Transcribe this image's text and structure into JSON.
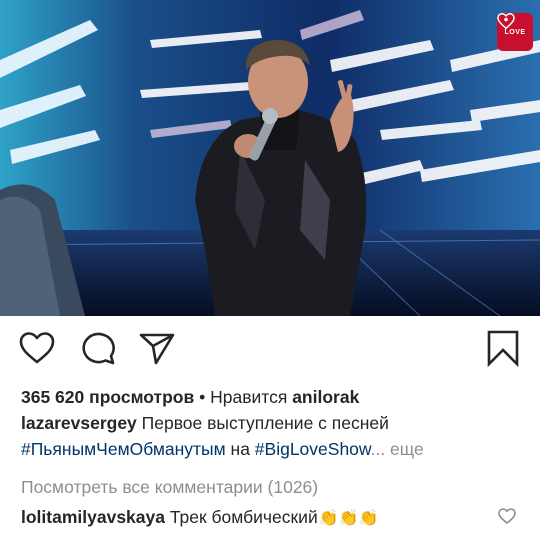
{
  "video": {
    "badge_text": "LOVE",
    "badge_color": "#c8102e"
  },
  "actions": {
    "like_icon": "heart-outline-icon",
    "comment_icon": "speech-bubble-icon",
    "share_icon": "paper-plane-icon",
    "save_icon": "bookmark-icon"
  },
  "stats": {
    "views": "365 620 просмотров",
    "separator": " • Нравится ",
    "liked_by": "anilorak"
  },
  "caption": {
    "username": "lazarevsergey",
    "text": " Первое выступление с песней",
    "hashtag1": "#ПьянымЧемОбманутым",
    "connector": " на ",
    "hashtag2": "#BigLoveShow",
    "ellipsis": "...",
    "more": " еще"
  },
  "comments": {
    "view_all": "Посмотреть все комментарии (1026)",
    "top": {
      "username": "lolitamilyavskaya",
      "text": " Трек бомбический",
      "emoji": "👏👏👏"
    }
  },
  "colors": {
    "text": "#262626",
    "hashtag": "#003569",
    "muted": "#8e8e8e"
  }
}
